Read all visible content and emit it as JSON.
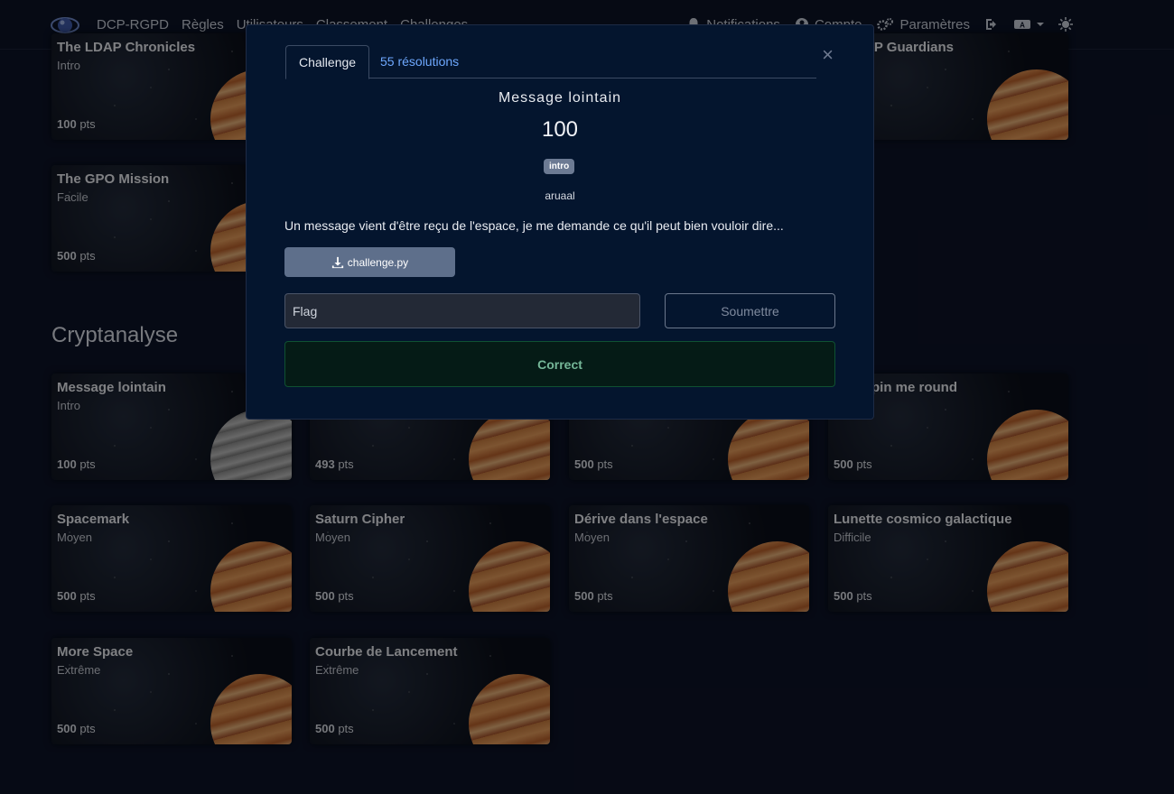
{
  "navbar": {
    "brand": "DCP-RGPD",
    "links": [
      "Règles",
      "Utilisateurs",
      "Classement",
      "Challenges"
    ],
    "notifications": "Notifications",
    "account": "Compte",
    "settings": "Paramètres"
  },
  "sections": {
    "top_cards": [
      {
        "title": "The LDAP Chronicles",
        "difficulty": "Intro",
        "points": "100",
        "unit": "pts"
      },
      {
        "title": "LDAP Guardians",
        "difficulty": "",
        "points": "",
        "unit": ""
      },
      {
        "title": "The GPO Mission",
        "difficulty": "Facile",
        "points": "500",
        "unit": "pts"
      }
    ],
    "crypto_title": "Cryptanalyse",
    "crypto_cards": [
      {
        "title": "Message lointain",
        "difficulty": "Intro",
        "points": "100",
        "unit": "pts"
      },
      {
        "title": "",
        "difficulty": "",
        "points": "493",
        "unit": "pts"
      },
      {
        "title": "",
        "difficulty": "",
        "points": "500",
        "unit": "pts"
      },
      {
        "title": "pin me round",
        "difficulty": "",
        "points": "500",
        "unit": "pts"
      },
      {
        "title": "Spacemark",
        "difficulty": "Moyen",
        "points": "500",
        "unit": "pts"
      },
      {
        "title": "Saturn Cipher",
        "difficulty": "Moyen",
        "points": "500",
        "unit": "pts"
      },
      {
        "title": "Dérive dans l'espace",
        "difficulty": "Moyen",
        "points": "500",
        "unit": "pts"
      },
      {
        "title": "Lunette cosmico galactique",
        "difficulty": "Difficile",
        "points": "500",
        "unit": "pts"
      },
      {
        "title": "More Space",
        "difficulty": "Extrême",
        "points": "500",
        "unit": "pts"
      },
      {
        "title": "Courbe de Lancement",
        "difficulty": "Extrême",
        "points": "500",
        "unit": "pts"
      }
    ]
  },
  "modal": {
    "tab_challenge": "Challenge",
    "tab_solves": "55 résolutions",
    "name": "Message lointain",
    "value": "100",
    "tag": "intro",
    "author": "aruaal",
    "description": "Un message vient d'être reçu de l'espace, je me demande ce qu'il peut bien vouloir dire...",
    "file": "challenge.py",
    "flag_placeholder": "Flag",
    "submit": "Soumettre",
    "result": "Correct",
    "close_symbol": "×"
  },
  "colors": {
    "accent_link": "#6ea8fe",
    "success_text": "#75b798",
    "modal_bg": "#04152e"
  }
}
